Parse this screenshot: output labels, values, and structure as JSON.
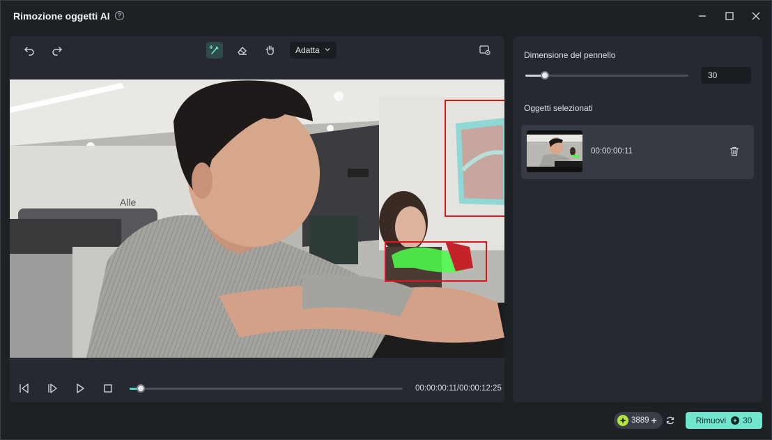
{
  "window": {
    "title": "Rimozione oggetti AI",
    "help_symbol": "?"
  },
  "toolbar": {
    "fit_label": "Adatta",
    "tools": [
      "undo-icon",
      "redo-icon",
      "smart-brush-icon",
      "eraser-icon",
      "hand-icon",
      "preview-compare-icon"
    ]
  },
  "player": {
    "timecode": "00:00:00:11/00:00:12:25",
    "progress": 0.04
  },
  "panel": {
    "brush_size_label": "Dimensione del pennello",
    "brush_size_value": "30",
    "brush_size_fraction": 0.12,
    "selected_objects_label": "Oggetti selezionati",
    "objects": [
      {
        "time": "00:00:00:11"
      }
    ]
  },
  "footer": {
    "credits": "3889",
    "add_symbol": "+",
    "remove_label": "Rimuovi",
    "remove_cost": "30"
  },
  "colors": {
    "accent": "#71e6ce",
    "selection_box": "#e0151c",
    "mask": "#4cff4c",
    "credit": "#b7e63a"
  }
}
